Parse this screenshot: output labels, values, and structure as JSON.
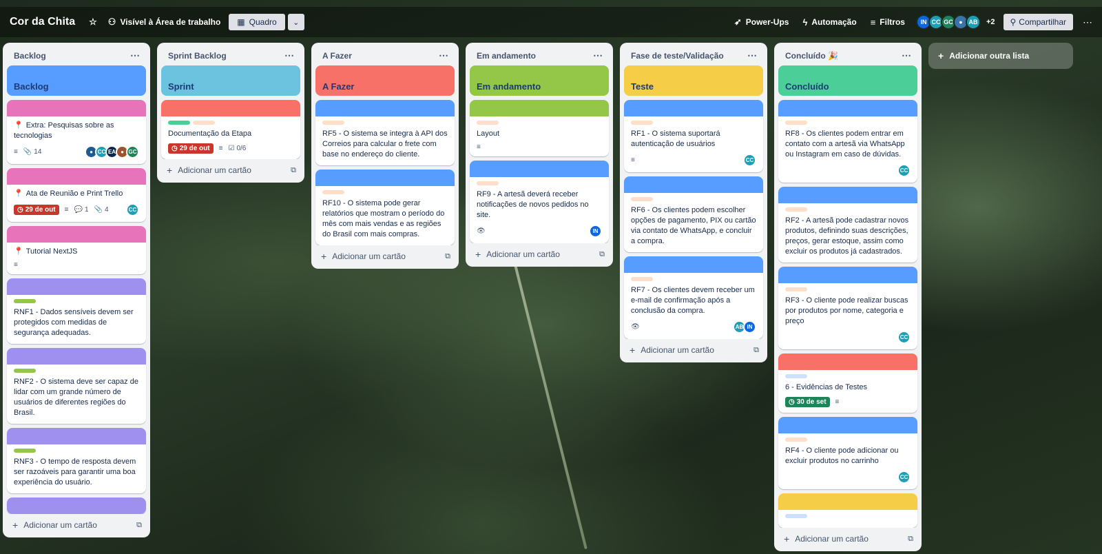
{
  "header": {
    "title": "Cor da Chita",
    "visibility": "Visível à Área de trabalho",
    "view": "Quadro",
    "powerups": "Power-Ups",
    "automation": "Automação",
    "filters": "Filtros",
    "avatars": [
      {
        "initials": "IN",
        "color": "#0c66e4"
      },
      {
        "initials": "CC",
        "color": "#1d9fb5"
      },
      {
        "initials": "GC",
        "color": "#1f845a"
      },
      {
        "initials": "",
        "color": "#3a73a8"
      },
      {
        "initials": "AB",
        "color": "#1d9fb5"
      }
    ],
    "more_members": "+2",
    "share": "Compartilhar"
  },
  "lists": [
    {
      "title": "Backlog",
      "add_card": "Adicionar um cartão",
      "cards": [
        {
          "kind": "cover",
          "cover_color": "#579dff",
          "title": "Backlog"
        },
        {
          "kind": "card",
          "cover_color": "#e774bb",
          "pinned": true,
          "title": "Extra: Pesquisas sobre as tecnologias",
          "description": true,
          "attachments": "14",
          "members": [
            {
              "initials": "",
              "color": "#1c5a8f"
            },
            {
              "initials": "CC",
              "color": "#1d9fb5"
            },
            {
              "initials": "EA",
              "color": "#0b2a4a"
            },
            {
              "initials": "",
              "color": "#a0522d"
            },
            {
              "initials": "GC",
              "color": "#1f845a"
            }
          ]
        },
        {
          "kind": "card",
          "cover_color": "#e774bb",
          "pinned": true,
          "title": "Ata de Reunião e Print Trello",
          "due": "29 de out",
          "due_color": "red",
          "description": true,
          "comments": "1",
          "attachments": "4",
          "members": [
            {
              "initials": "CC",
              "color": "#1d9fb5"
            }
          ]
        },
        {
          "kind": "card",
          "cover_color": "#e774bb",
          "pinned": true,
          "title": "Tutorial NextJS",
          "description": true
        },
        {
          "kind": "card",
          "cover_color": "#9f8fef",
          "labels": [
            "#94c748"
          ],
          "title": "RNF1 - Dados sensíveis devem ser protegidos com medidas de segurança adequadas."
        },
        {
          "kind": "card",
          "cover_color": "#9f8fef",
          "labels": [
            "#94c748"
          ],
          "title": "RNF2 - O sistema deve ser capaz de lidar com um grande número de usuários de diferentes regiões do Brasil."
        },
        {
          "kind": "card",
          "cover_color": "#9f8fef",
          "labels": [
            "#94c748"
          ],
          "title": "RNF3 - O tempo de resposta devem ser razoáveis para garantir uma boa experiência do usuário."
        },
        {
          "kind": "card",
          "cover_color": "#9f8fef",
          "title": ""
        }
      ]
    },
    {
      "title": "Sprint Backlog",
      "add_card": "Adicionar um cartão",
      "cards": [
        {
          "kind": "cover",
          "cover_color": "#6cc3e0",
          "title": "Sprint"
        },
        {
          "kind": "card",
          "cover_color": "#f87168",
          "labels": [
            "#4bce97",
            "#fedec8"
          ],
          "title": "Documentação da Etapa",
          "due": "29 de out",
          "due_color": "red",
          "description": true,
          "checklist": "0/6"
        }
      ]
    },
    {
      "title": "A Fazer",
      "add_card": "Adicionar um cartão",
      "cards": [
        {
          "kind": "cover",
          "cover_color": "#f87168",
          "title": "A Fazer"
        },
        {
          "kind": "card",
          "cover_color": "#579dff",
          "labels": [
            "#fedec8"
          ],
          "title": "RF5 - O sistema se integra à API dos Correios para calcular o frete com base no endereço do cliente."
        },
        {
          "kind": "card",
          "cover_color": "#579dff",
          "labels": [
            "#fedec8"
          ],
          "title": "RF10 - O sistema pode gerar relatórios que mostram o período do mês com mais vendas e as regiões do Brasil com mais compras."
        }
      ]
    },
    {
      "title": "Em andamento",
      "add_card": "Adicionar um cartão",
      "cards": [
        {
          "kind": "cover",
          "cover_color": "#94c748",
          "title": "Em andamento"
        },
        {
          "kind": "card",
          "cover_color": "#94c748",
          "labels": [
            "#fedec8"
          ],
          "title": "Layout",
          "description": true
        },
        {
          "kind": "card",
          "cover_color": "#579dff",
          "labels": [
            "#fedec8"
          ],
          "title": "RF9 - A artesã deverá receber notificações de novos pedidos no site.",
          "watching": true,
          "members": [
            {
              "initials": "IN",
              "color": "#0c66e4"
            }
          ]
        }
      ]
    },
    {
      "title": "Fase de teste/Validação",
      "add_card": "Adicionar um cartão",
      "cards": [
        {
          "kind": "cover",
          "cover_color": "#f5cd47",
          "title": "Teste"
        },
        {
          "kind": "card",
          "cover_color": "#579dff",
          "labels": [
            "#fedec8"
          ],
          "title": "RF1 - O sistema suportará autenticação de usuários",
          "description": true,
          "members": [
            {
              "initials": "CC",
              "color": "#1d9fb5"
            }
          ]
        },
        {
          "kind": "card",
          "cover_color": "#579dff",
          "labels": [
            "#fedec8"
          ],
          "title": "RF6 - Os clientes podem escolher opções de pagamento, PIX ou cartão via contato de WhatsApp, e concluir a compra."
        },
        {
          "kind": "card",
          "cover_color": "#579dff",
          "labels": [
            "#fedec8"
          ],
          "title": "RF7 - Os clientes devem receber um e-mail de confirmação após a conclusão da compra.",
          "watching": true,
          "members": [
            {
              "initials": "AB",
              "color": "#1d9fb5"
            },
            {
              "initials": "IN",
              "color": "#0c66e4"
            }
          ]
        }
      ]
    },
    {
      "title": "Concluído 🎉",
      "add_card": "Adicionar um cartão",
      "cards": [
        {
          "kind": "cover",
          "cover_color": "#4bce97",
          "title": "Concluído"
        },
        {
          "kind": "card",
          "cover_color": "#579dff",
          "labels": [
            "#fedec8"
          ],
          "title": "RF8 - Os clientes podem entrar em contato com a artesã via WhatsApp ou Instagram em caso de dúvidas.",
          "members": [
            {
              "initials": "CC",
              "color": "#1d9fb5"
            }
          ]
        },
        {
          "kind": "card",
          "cover_color": "#579dff",
          "labels": [
            "#fedec8"
          ],
          "title": "RF2 - A artesã pode cadastrar novos produtos, definindo suas descrições, preços, gerar estoque, assim como excluir os produtos já cadastrados."
        },
        {
          "kind": "card",
          "cover_color": "#579dff",
          "labels": [
            "#fedec8"
          ],
          "title": "RF3 - O cliente pode realizar buscas por produtos por nome, categoria e preço",
          "members": [
            {
              "initials": "CC",
              "color": "#1d9fb5"
            }
          ]
        },
        {
          "kind": "card",
          "cover_color": "#f87168",
          "labels": [
            "#cce0ff"
          ],
          "title": "6 - Evidências de Testes",
          "due": "30 de set",
          "due_color": "green",
          "description": true
        },
        {
          "kind": "card",
          "cover_color": "#579dff",
          "labels": [
            "#fedec8"
          ],
          "title": "RF4 - O cliente pode adicionar ou excluir produtos no carrinho",
          "members": [
            {
              "initials": "CC",
              "color": "#1d9fb5"
            }
          ]
        },
        {
          "kind": "card",
          "cover_color": "#f5cd47",
          "labels": [
            "#cce0ff"
          ],
          "title": ""
        }
      ]
    }
  ],
  "add_list": "Adicionar outra lista",
  "icons": {
    "star": "star-icon",
    "visibility": "people-icon",
    "board": "board-icon",
    "powerups": "rocket-icon",
    "automation": "bolt-icon",
    "filter": "filter-icon",
    "share": "add-person-icon",
    "more": "more-icon",
    "pin": "pushpin-icon",
    "description": "description-icon",
    "attachment": "paperclip-icon",
    "comment": "comment-icon",
    "checklist": "checklist-icon",
    "watch": "eye-icon",
    "clock": "clock-icon",
    "template": "template-icon",
    "plus": "plus-icon"
  }
}
